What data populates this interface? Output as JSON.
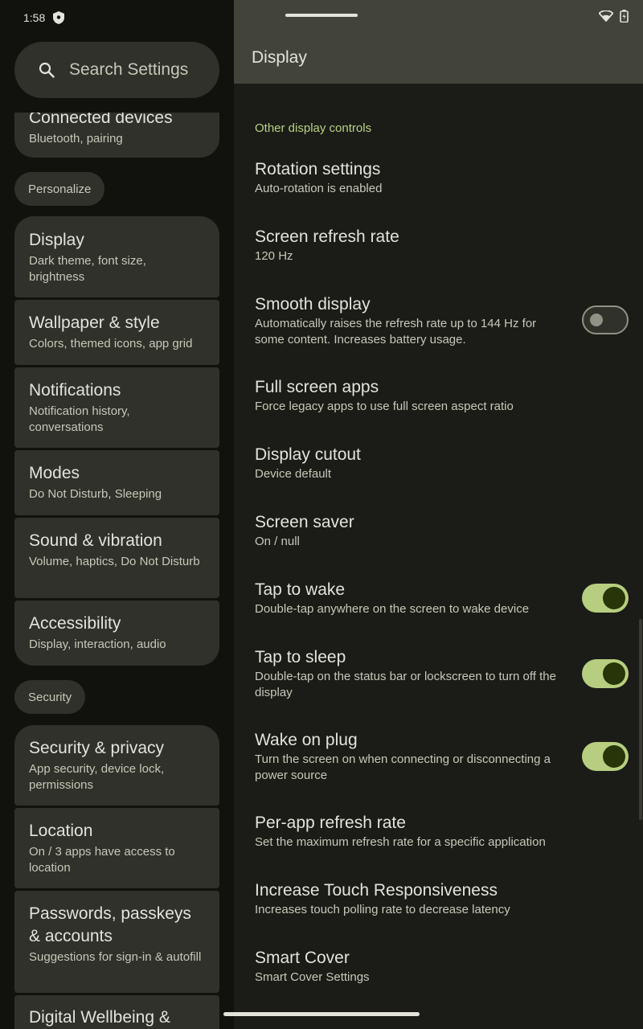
{
  "status_bar": {
    "time": "1:58"
  },
  "search": {
    "label": "Search Settings"
  },
  "nav": {
    "connected": {
      "title": "Connected devices",
      "subtitle": "Bluetooth, pairing"
    },
    "personalize_header": "Personalize",
    "display": {
      "title": "Display",
      "subtitle": "Dark theme, font size, brightness"
    },
    "wallpaper": {
      "title": "Wallpaper & style",
      "subtitle": "Colors, themed icons, app grid"
    },
    "notifications": {
      "title": "Notifications",
      "subtitle": "Notification history, conversations"
    },
    "modes": {
      "title": "Modes",
      "subtitle": "Do Not Disturb, Sleeping"
    },
    "sound": {
      "title": "Sound & vibration",
      "subtitle": "Volume, haptics, Do Not Disturb"
    },
    "accessibility": {
      "title": "Accessibility",
      "subtitle": "Display, interaction, audio"
    },
    "security_header": "Security",
    "security_privacy": {
      "title": "Security & privacy",
      "subtitle": "App security, device lock, permissions"
    },
    "location": {
      "title": "Location",
      "subtitle": "On / 3 apps have access to location"
    },
    "passwords": {
      "title": "Passwords, passkeys & accounts",
      "subtitle": "Suggestions for sign-in & autofill"
    },
    "wellbeing": {
      "title": "Digital Wellbeing &"
    }
  },
  "page": {
    "title": "Display",
    "section": "Other display controls",
    "items": {
      "rotation": {
        "title": "Rotation settings",
        "subtitle": "Auto-rotation is enabled"
      },
      "refresh": {
        "title": "Screen refresh rate",
        "subtitle": "120 Hz"
      },
      "smooth": {
        "title": "Smooth display",
        "subtitle": "Automatically raises the refresh rate up to 144 Hz for some content. Increases battery usage.",
        "enabled": false
      },
      "fullscreen": {
        "title": "Full screen apps",
        "subtitle": "Force legacy apps to use full screen aspect ratio"
      },
      "cutout": {
        "title": "Display cutout",
        "subtitle": "Device default"
      },
      "saver": {
        "title": "Screen saver",
        "subtitle": "On / null"
      },
      "tap_wake": {
        "title": "Tap to wake",
        "subtitle": "Double-tap anywhere on the screen to wake device",
        "enabled": true
      },
      "tap_sleep": {
        "title": "Tap to sleep",
        "subtitle": "Double-tap on the status bar or lockscreen to turn off the display",
        "enabled": true
      },
      "wake_plug": {
        "title": "Wake on plug",
        "subtitle": "Turn the screen on when connecting or disconnecting a power source",
        "enabled": true
      },
      "per_app": {
        "title": "Per-app refresh rate",
        "subtitle": "Set the maximum refresh rate for a specific application"
      },
      "touch": {
        "title": "Increase Touch Responsiveness",
        "subtitle": "Increases touch polling rate to decrease latency"
      },
      "cover": {
        "title": "Smart Cover",
        "subtitle": "Smart Cover Settings"
      }
    }
  },
  "colors": {
    "accent": "#b9d084",
    "switch_on": "#b7ce80",
    "header": "#42443b",
    "card": "#2f312a"
  },
  "icons": [
    "shield-icon",
    "search-icon",
    "wifi-icon",
    "battery-icon"
  ]
}
